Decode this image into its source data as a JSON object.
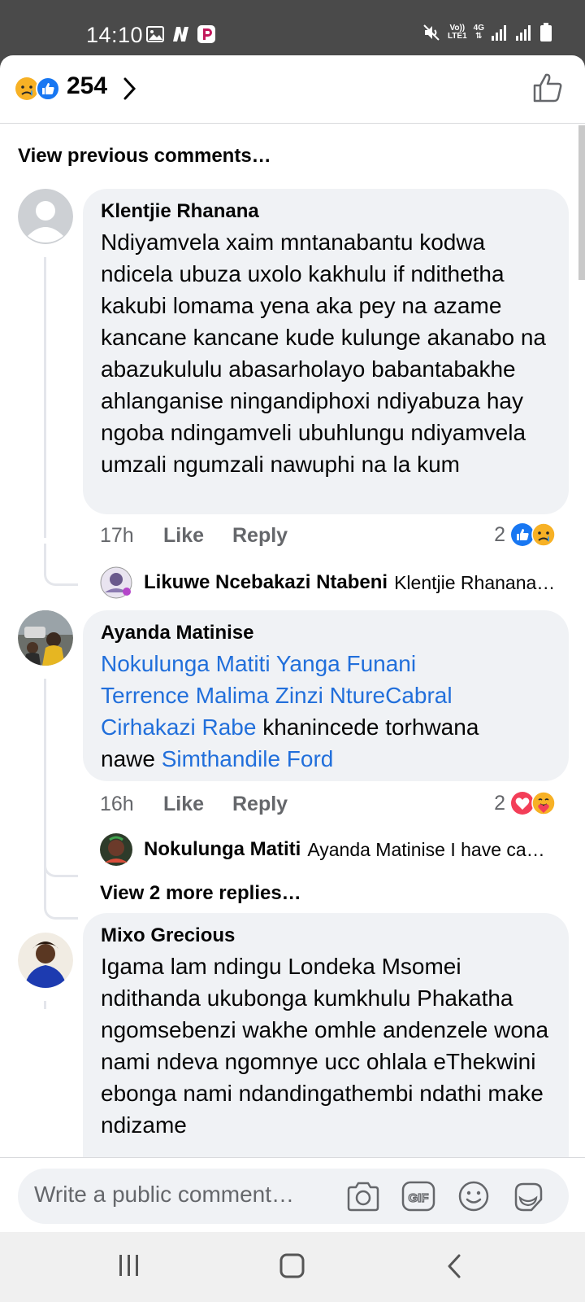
{
  "status_bar": {
    "time": "14:10",
    "left_icons": [
      "image-icon",
      "netflix-n-icon",
      "p-app-icon"
    ],
    "right_icons": [
      "mute-icon",
      "volte-icon",
      "4g-icon",
      "signal-icon",
      "signal-icon",
      "battery-icon"
    ],
    "volte_label": "Vo))\nLTE1",
    "network_label": "4G"
  },
  "header": {
    "reaction_count": "254",
    "reaction_icons": [
      "sad-reaction-icon",
      "like-reaction-icon"
    ]
  },
  "view_previous": "View previous comments…",
  "comments": [
    {
      "author": "Klentjie Rhanana",
      "text": "Ndiyamvela xaim mntanabantu kodwa ndicela ubuza uxolo kakhulu if ndithetha kakubi lomama yena aka pey na azame kancane kancane kude kulunge akanabo na abazukululu abasarholayo babantabakhe ahlanganise ningandiphoxi ndiyabuza hay ngoba ndingamveli ubuhlungu ndiyamvela umzali ngumzali nawuphi na la kum",
      "time": "17h",
      "like_label": "Like",
      "reply_label": "Reply",
      "reaction_count": "2",
      "reactions": [
        "like-reaction-icon",
        "sad-reaction-icon"
      ],
      "reply_preview": {
        "author": "Likuwe Ncebakazi Ntabeni",
        "text": "Klentjie Rhanana…"
      }
    },
    {
      "author": "Ayanda Matinise",
      "mentions_line1": "Nokulunga Matiti Yanga Funani",
      "mentions_line2": "Terrence Malima Zinzi NtureCabral",
      "mention3": "Cirhakazi Rabe",
      "text_after": " khanincede torhwana",
      "text_line4": "nawe ",
      "mention4": "Simthandile Ford",
      "time": "16h",
      "like_label": "Like",
      "reply_label": "Reply",
      "reaction_count": "2",
      "reactions": [
        "love-reaction-icon",
        "care-reaction-icon"
      ],
      "reply_preview": {
        "author": "Nokulunga Matiti",
        "text": "Ayanda Matinise I have ca…"
      },
      "view_more": "View 2 more replies…"
    },
    {
      "author": "Mixo Grecious",
      "text": "Igama lam ndingu Londeka Msomei ndithanda ukubonga kumkhulu Phakatha ngomsebenzi wakhe omhle andenzele wona nami ndeva ngomnye ucc ohlala eThekwini ebonga nami ndandingathembi ndathi make ndizame"
    }
  ],
  "composer": {
    "placeholder": "Write a public comment…",
    "icons": [
      "camera-icon",
      "gif-icon",
      "emoji-icon",
      "sticker-icon"
    ]
  },
  "nav_bar": {
    "icons": [
      "recent-apps-icon",
      "home-icon",
      "back-icon"
    ]
  },
  "colors": {
    "mention": "#216fdb",
    "bubble": "#f0f2f5",
    "like_blue": "#1877f2",
    "love_red": "#f33e58",
    "status_bar": "#4a4a4a"
  }
}
